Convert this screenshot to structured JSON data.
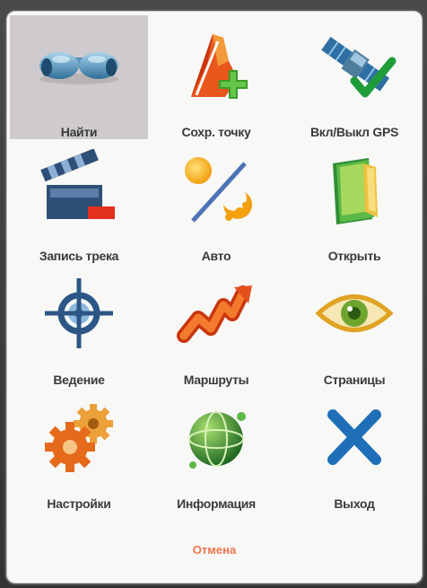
{
  "menu": {
    "items": [
      {
        "label": "Найти",
        "icon": "binoculars-icon"
      },
      {
        "label": "Сохр. точку",
        "icon": "save-point-icon"
      },
      {
        "label": "Вкл/Выкл GPS",
        "icon": "gps-satellite-icon"
      },
      {
        "label": "Запись трека",
        "icon": "track-record-icon"
      },
      {
        "label": "Авто",
        "icon": "day-night-icon"
      },
      {
        "label": "Открыть",
        "icon": "open-book-icon"
      },
      {
        "label": "Ведение",
        "icon": "crosshair-icon"
      },
      {
        "label": "Маршруты",
        "icon": "routes-icon"
      },
      {
        "label": "Страницы",
        "icon": "eye-icon"
      },
      {
        "label": "Настройки",
        "icon": "gears-icon"
      },
      {
        "label": "Информация",
        "icon": "globe-icon"
      },
      {
        "label": "Выход",
        "icon": "close-icon"
      }
    ],
    "selected_index": 0,
    "cancel_label": "Отмена"
  },
  "colors": {
    "selected_bg": "#cfcacd",
    "label": "#3a3a3a",
    "cancel": "#f0764c",
    "panel": "#f8f8f6"
  }
}
